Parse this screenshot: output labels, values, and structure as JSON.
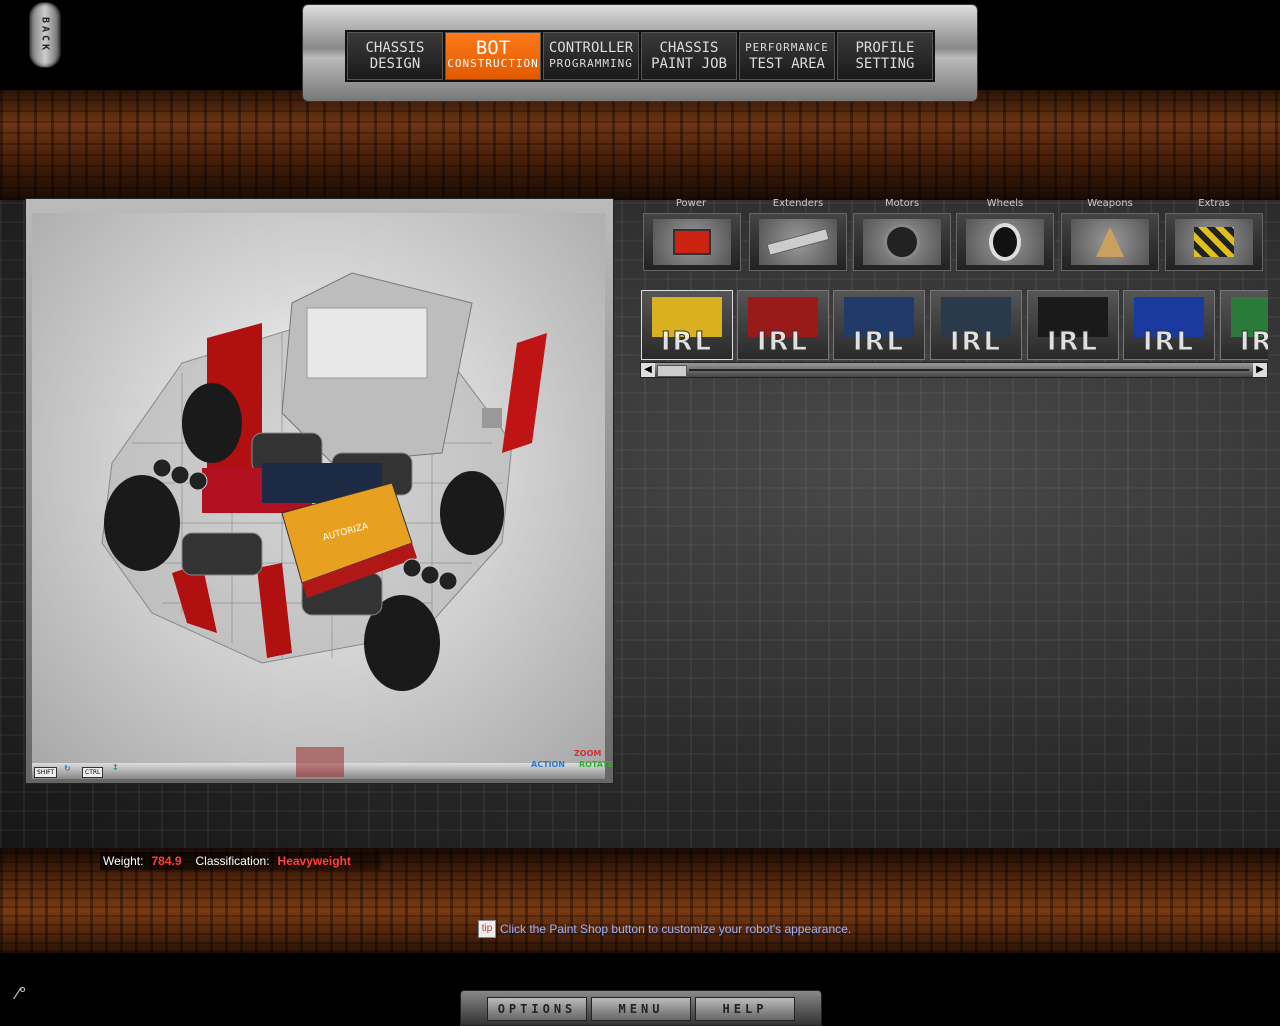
{
  "back_button": {
    "label": "BACK"
  },
  "nav": {
    "tabs": [
      {
        "line1": "CHASSIS",
        "line2": "DESIGN",
        "active": false
      },
      {
        "line1": "BOT",
        "line2": "CONSTRUCTION",
        "active": true
      },
      {
        "line1": "CONTROLLER",
        "line2": "PROGRAMMING",
        "active": false
      },
      {
        "line1": "CHASSIS",
        "line2": "PAINT JOB",
        "active": false
      },
      {
        "line1": "PERFORMANCE",
        "line2": "TEST AREA",
        "active": false
      },
      {
        "line1": "PROFILE",
        "line2": "SETTING",
        "active": false
      }
    ]
  },
  "viewport": {
    "controls": {
      "shift": "SHIFT",
      "ctrl": "CTRL",
      "zoom": "ZOOM",
      "action": "ACTION",
      "rotate": "ROTATE"
    },
    "battery_label": "AUTORIZA"
  },
  "categories": [
    {
      "label": "Power",
      "icon": "battery-icon"
    },
    {
      "label": "Extenders",
      "icon": "extender-bar-icon"
    },
    {
      "label": "Motors",
      "icon": "motor-icon"
    },
    {
      "label": "Wheels",
      "icon": "wheel-icon"
    },
    {
      "label": "Weapons",
      "icon": "saw-blade-icon"
    },
    {
      "label": "Extras",
      "icon": "hazard-stripe-icon"
    }
  ],
  "items": [
    {
      "brand": "IRL",
      "color": "#d8b020"
    },
    {
      "brand": "IRL",
      "color": "#9a1a1a"
    },
    {
      "brand": "IRL",
      "color": "#203a6a"
    },
    {
      "brand": "IRL",
      "color": "#2a3a4a"
    },
    {
      "brand": "IRL",
      "color": "#1a1a1a"
    },
    {
      "brand": "IRL",
      "color": "#1a3aa0"
    },
    {
      "brand": "IRL",
      "color": "#2a7a3a"
    }
  ],
  "status": {
    "weight_label": "Weight:",
    "weight_value": "784.9",
    "class_label": "Classification:",
    "class_value": "Heavyweight"
  },
  "tip": {
    "icon_text": "tip",
    "text": "Click the Paint Shop button to customize your robot's appearance."
  },
  "bottom_menu": {
    "options": "OPTIONS",
    "menu": "MENU",
    "help": "HELP"
  },
  "colors": {
    "accent": "#ff7a1a",
    "danger": "#ff4040",
    "tip": "#9ab0ff"
  }
}
